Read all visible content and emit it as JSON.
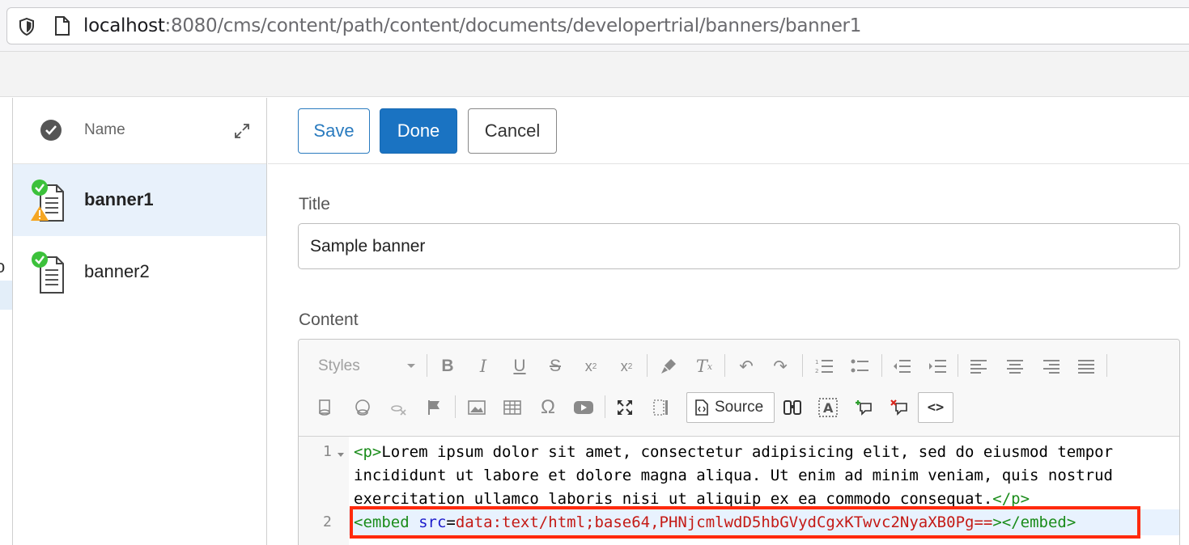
{
  "browser": {
    "url_host": "localhost",
    "url_rest": ":8080/cms/content/path/content/documents/developertrial/banners/banner1"
  },
  "left_fragment": "o",
  "list": {
    "header_name": "Name",
    "items": [
      {
        "label": "banner1",
        "status": "published-with-warning",
        "selected": true
      },
      {
        "label": "banner2",
        "status": "published",
        "selected": false
      }
    ]
  },
  "editor": {
    "save_label": "Save",
    "done_label": "Done",
    "cancel_label": "Cancel",
    "title_label": "Title",
    "title_value": "Sample banner",
    "content_label": "Content",
    "toolbar": {
      "styles_placeholder": "Styles",
      "source_label": "Source",
      "code_label": "<>"
    },
    "code": {
      "line1_number": "1",
      "line2_number": "2",
      "line1a_open": "<p>",
      "line1a_text": "Lorem ipsum dolor sit amet, consectetur adipisicing elit, sed do eiusmod tempor",
      "line1b": "incididunt ut labore et dolore magna aliqua. Ut enim ad minim veniam, quis nostrud",
      "line1c_text": "exercitation ullamco laboris nisi ut aliquip ex ea commodo consequat.",
      "line1c_close": "</p>",
      "line2_open": "<embed ",
      "line2_attr": "src",
      "line2_eq": "=",
      "line2_val": "data:text/html;base64,PHNjcmlwdD5hbGVydCgxKTwvc2NyaXB0Pg==",
      "line2_gt": ">",
      "line2_close": "</embed>"
    }
  },
  "colors": {
    "primary": "#1a73c2",
    "highlight_box": "#ff2a0d",
    "tag": "#1a8c1a",
    "attr": "#1c1ccc",
    "value": "#c41a16",
    "status_ok": "#3cc13b",
    "status_warn": "#f5a623"
  }
}
